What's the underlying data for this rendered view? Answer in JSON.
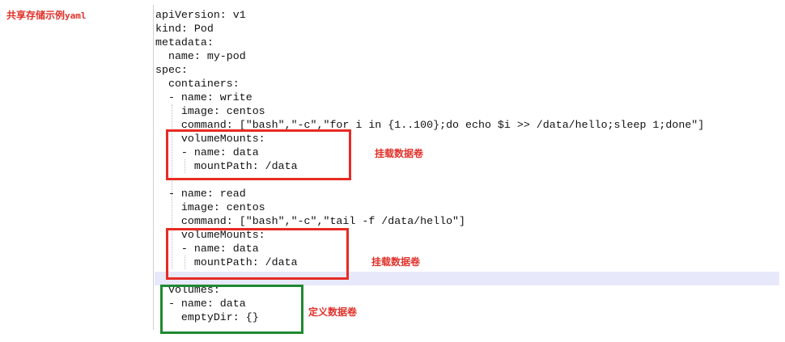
{
  "side_title": {
    "text": "共享存储示例",
    "suffix": "yaml"
  },
  "code_lines": [
    "apiVersion: v1",
    "kind: Pod",
    "metadata:",
    "  name: my-pod",
    "spec:",
    "  containers:",
    "  - name: write",
    "    image: centos",
    "    command: [\"bash\",\"-c\",\"for i in {1..100};do echo $i >> /data/hello;sleep 1;done\"]",
    "    volumeMounts:",
    "    - name: data",
    "      mountPath: /data",
    "",
    "  - name: read",
    "    image: centos",
    "    command: [\"bash\",\"-c\",\"tail -f /data/hello\"]",
    "    volumeMounts:",
    "    - name: data",
    "      mountPath: /data",
    "",
    "  volumes:",
    "  - name: data",
    "    emptyDir: {}"
  ],
  "annotations": {
    "mount_write": "挂载数据卷",
    "mount_read": "挂载数据卷",
    "define_volume": "定义数据卷"
  },
  "colors": {
    "annotation_text": "#e0322a",
    "red_box": "#e62b24",
    "green_box": "#1f8a32",
    "current_line_highlight": "#e8e8fb"
  }
}
